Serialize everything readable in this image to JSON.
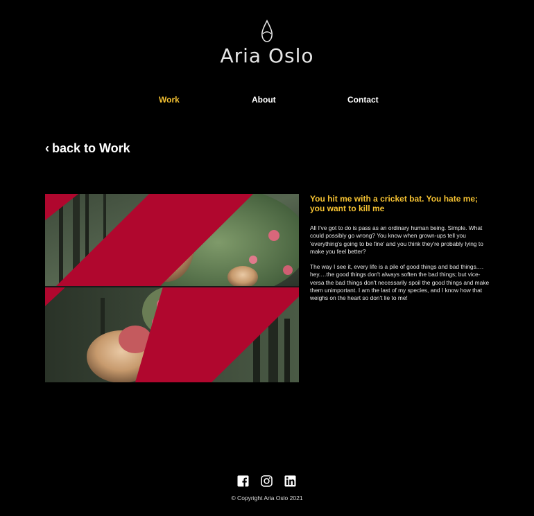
{
  "brand": {
    "name": "Aria Oslo",
    "logo_icon": "drop-icon"
  },
  "nav": {
    "items": [
      {
        "label": "Work",
        "active": true
      },
      {
        "label": "About",
        "active": false
      },
      {
        "label": "Contact",
        "active": false
      }
    ]
  },
  "back_link": {
    "chevron": "‹",
    "label": "back to Work"
  },
  "article": {
    "title": "You hit me with a cricket bat. You hate me; you want to kill me",
    "paragraphs": [
      "All I've got to do is pass as an ordinary human being. Simple. What could possibly go wrong? You know when grown-ups tell you 'everything's going to be fine' and you think they're probably lying to make you feel better?",
      "The way I see it, every life is a pile of good things and bad things.…hey.…the good things don't always soften the bad things; but vice-versa the bad things don't necessarily spoil the good things and make them unimportant. I am the last of my species, and I know how that weighs on the heart so don't lie to me!"
    ]
  },
  "footer": {
    "social": [
      {
        "icon": "facebook-icon"
      },
      {
        "icon": "instagram-icon"
      },
      {
        "icon": "linkedin-icon"
      }
    ],
    "copyright": "© Copyright Aria Oslo 2021"
  },
  "colors": {
    "background": "#000000",
    "accent": "#f5c232",
    "text": "#ffffff",
    "stripe": "#b0072e"
  }
}
